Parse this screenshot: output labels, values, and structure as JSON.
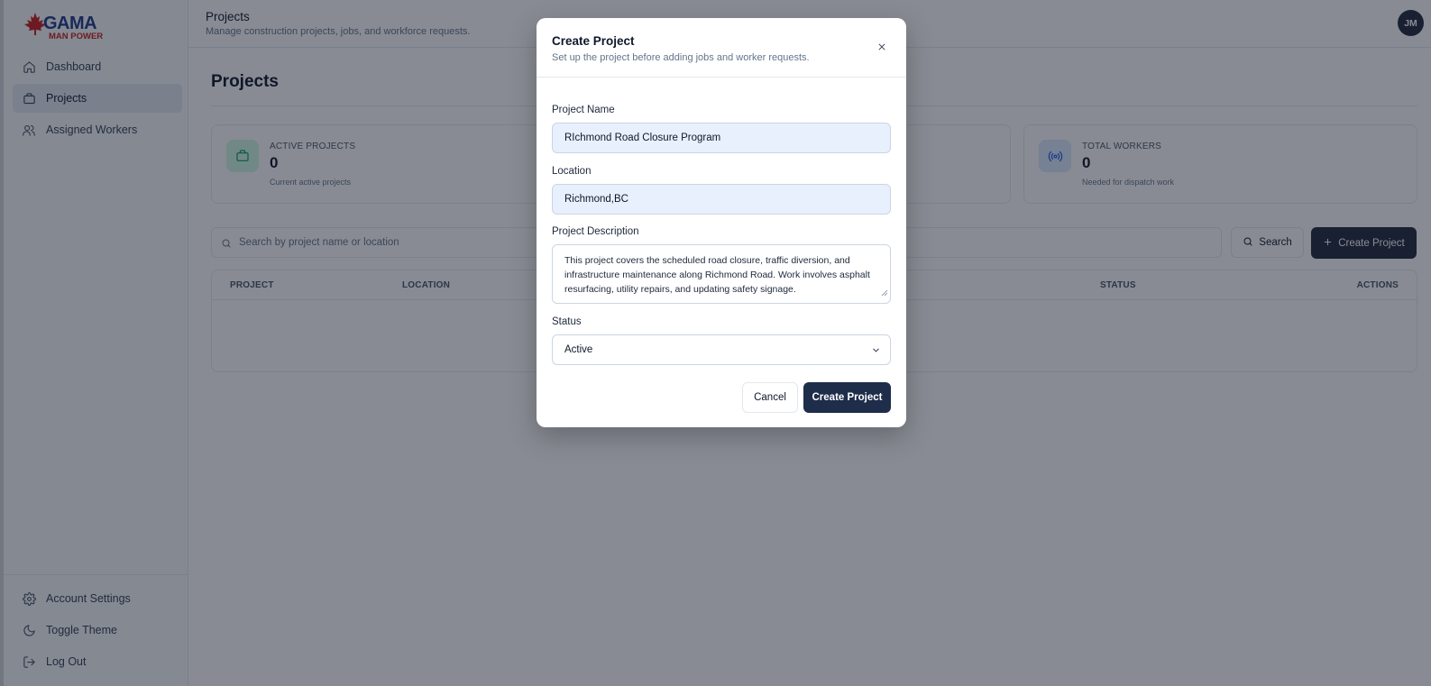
{
  "brand": {
    "logo_text": "GAMA",
    "logo_subtext": "MAN POWER"
  },
  "sidebar": {
    "items": [
      {
        "label": "Dashboard",
        "icon": "home-icon"
      },
      {
        "label": "Projects",
        "icon": "briefcase-icon",
        "active": true
      },
      {
        "label": "Assigned Workers",
        "icon": "users-icon"
      }
    ],
    "bottom_items": [
      {
        "label": "Account Settings",
        "icon": "gear-icon"
      },
      {
        "label": "Toggle Theme",
        "icon": "moon-icon"
      },
      {
        "label": "Log Out",
        "icon": "logout-icon"
      }
    ]
  },
  "header": {
    "title": "Projects",
    "subtitle": "Manage construction projects, jobs, and workforce requests.",
    "avatar_initials": "JM"
  },
  "main": {
    "page_title": "Projects",
    "stats": [
      {
        "label": "ACTIVE PROJECTS",
        "value": "0",
        "note": "Current active projects",
        "icon": "briefcase-icon",
        "accent": "#059669"
      },
      {
        "label": "TOTAL WORKERS",
        "value": "0",
        "note": "Needed for dispatch work",
        "icon": "broadcast-icon",
        "accent": "#2563eb"
      }
    ],
    "search": {
      "placeholder": "Search by project name or location",
      "button_label": "Search"
    },
    "create_button_label": "Create Project",
    "table": {
      "columns": [
        "PROJECT",
        "LOCATION",
        "STATUS",
        "ACTIONS"
      ]
    }
  },
  "modal": {
    "title": "Create Project",
    "subtitle": "Set up the project before adding jobs and worker requests.",
    "fields": {
      "project_name": {
        "label": "Project Name",
        "value": "RIchmond Road Closure Program"
      },
      "location": {
        "label": "Location",
        "value": "Richmond,BC"
      },
      "description": {
        "label": "Project Description",
        "value": "This project covers the scheduled road closure, traffic diversion, and infrastructure maintenance along Richmond Road. Work involves asphalt resurfacing, utility repairs, and updating safety signage."
      },
      "status": {
        "label": "Status",
        "value": "Active"
      }
    },
    "cancel_label": "Cancel",
    "submit_label": "Create Project"
  },
  "colors": {
    "primary": "#1e293b",
    "overlay": "rgba(17,24,39,0.5)",
    "logo_red": "#c81e1e",
    "logo_navy": "#1e3a8a"
  }
}
